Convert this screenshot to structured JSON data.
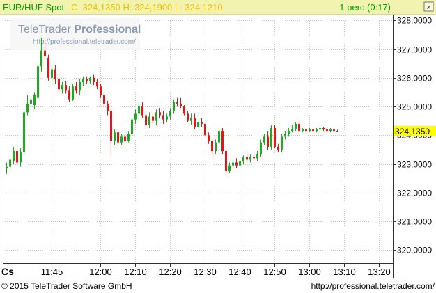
{
  "header": {
    "instrument": "EUR/HUF Spot",
    "quote_text": "C: 324,1350 H: 324,1900 L: 324,1210",
    "interval": "1 perc (0:17)"
  },
  "watermark": {
    "brand_light": "TeleTrader ",
    "brand_bold": "Professional",
    "url": "http://professional.teletrader.com/"
  },
  "price_tag": "324,1350",
  "xaxis_corner_label": "Cs",
  "footer": {
    "copyright": "© 2015 TeleTrader Software GmbH",
    "url": "http://professional.teletrader.com/"
  },
  "colors": {
    "up": "#22a822",
    "down": "#e01818",
    "header_bg": "#f3f3b0",
    "quote_text": "#f0c000",
    "price_tag_bg": "#ffff00",
    "grid": "#c8c8c8"
  },
  "chart_data": {
    "type": "candlestick",
    "title": "EUR/HUF Spot",
    "interval": "1 perc",
    "xlabel": "",
    "ylabel": "",
    "grid": true,
    "ylim": [
      319.55,
      328.2
    ],
    "xlim": [
      "11:32",
      "13:24"
    ],
    "y_ticks": [
      "320,0000",
      "321,0000",
      "322,0000",
      "323,0000",
      "324,0000",
      "325,0000",
      "326,0000",
      "327,0000",
      "328,0000"
    ],
    "y_tick_values": [
      320,
      321,
      322,
      323,
      324,
      325,
      326,
      327,
      328
    ],
    "x_ticks": [
      "11:45",
      "12:00",
      "12:10",
      "12:20",
      "12:30",
      "12:40",
      "12:50",
      "13:00",
      "13:10",
      "13:20"
    ],
    "x_tick_times": [
      "11:46",
      "12:00",
      "12:10",
      "12:20",
      "12:30",
      "12:40",
      "12:50",
      "13:00",
      "13:10",
      "13:20"
    ],
    "last_price": 324.135,
    "candles": [
      {
        "t": "11:33",
        "o": 322.85,
        "h": 323.05,
        "l": 322.65,
        "c": 322.9
      },
      {
        "t": "11:34",
        "o": 322.9,
        "h": 323.25,
        "l": 322.8,
        "c": 323.15
      },
      {
        "t": "11:35",
        "o": 323.1,
        "h": 323.6,
        "l": 323.0,
        "c": 323.45
      },
      {
        "t": "11:36",
        "o": 323.45,
        "h": 323.55,
        "l": 322.95,
        "c": 323.05
      },
      {
        "t": "11:37",
        "o": 323.05,
        "h": 323.55,
        "l": 322.9,
        "c": 323.4
      },
      {
        "t": "11:38",
        "o": 323.4,
        "h": 324.9,
        "l": 323.3,
        "c": 324.8
      },
      {
        "t": "11:39",
        "o": 324.8,
        "h": 325.4,
        "l": 324.7,
        "c": 325.1
      },
      {
        "t": "11:40",
        "o": 325.1,
        "h": 325.4,
        "l": 324.9,
        "c": 325.25
      },
      {
        "t": "11:41",
        "o": 325.05,
        "h": 325.5,
        "l": 324.9,
        "c": 325.4
      },
      {
        "t": "11:42",
        "o": 325.3,
        "h": 326.5,
        "l": 325.2,
        "c": 326.4
      },
      {
        "t": "11:43",
        "o": 326.4,
        "h": 327.4,
        "l": 326.2,
        "c": 326.95
      },
      {
        "t": "11:44",
        "o": 326.95,
        "h": 327.25,
        "l": 326.6,
        "c": 326.75
      },
      {
        "t": "11:45",
        "o": 326.7,
        "h": 326.8,
        "l": 325.9,
        "c": 326.0
      },
      {
        "t": "11:46",
        "o": 326.0,
        "h": 326.4,
        "l": 325.7,
        "c": 326.3
      },
      {
        "t": "11:47",
        "o": 326.3,
        "h": 326.45,
        "l": 325.8,
        "c": 325.95
      },
      {
        "t": "11:48",
        "o": 325.95,
        "h": 326.0,
        "l": 325.5,
        "c": 325.6
      },
      {
        "t": "11:49",
        "o": 325.6,
        "h": 325.85,
        "l": 325.45,
        "c": 325.75
      },
      {
        "t": "11:50",
        "o": 325.75,
        "h": 325.9,
        "l": 325.45,
        "c": 325.55
      },
      {
        "t": "11:51",
        "o": 325.55,
        "h": 325.7,
        "l": 325.15,
        "c": 325.25
      },
      {
        "t": "11:52",
        "o": 325.25,
        "h": 325.8,
        "l": 325.2,
        "c": 325.7
      },
      {
        "t": "11:53",
        "o": 325.7,
        "h": 325.85,
        "l": 325.45,
        "c": 325.55
      },
      {
        "t": "11:54",
        "o": 325.55,
        "h": 325.95,
        "l": 325.4,
        "c": 325.85
      },
      {
        "t": "11:55",
        "o": 325.85,
        "h": 326.05,
        "l": 325.7,
        "c": 325.95
      },
      {
        "t": "11:56",
        "o": 325.95,
        "h": 326.05,
        "l": 325.8,
        "c": 325.9
      },
      {
        "t": "11:57",
        "o": 325.9,
        "h": 326.05,
        "l": 325.8,
        "c": 326.0
      },
      {
        "t": "11:58",
        "o": 326.0,
        "h": 326.1,
        "l": 325.75,
        "c": 325.85
      },
      {
        "t": "11:59",
        "o": 325.85,
        "h": 325.95,
        "l": 325.6,
        "c": 325.7
      },
      {
        "t": "12:00",
        "o": 325.7,
        "h": 325.8,
        "l": 325.3,
        "c": 325.4
      },
      {
        "t": "12:01",
        "o": 325.4,
        "h": 325.5,
        "l": 325.0,
        "c": 325.1
      },
      {
        "t": "12:02",
        "o": 325.1,
        "h": 325.2,
        "l": 324.7,
        "c": 324.85
      },
      {
        "t": "12:03",
        "o": 324.85,
        "h": 324.95,
        "l": 323.3,
        "c": 323.8
      },
      {
        "t": "12:04",
        "o": 323.8,
        "h": 324.2,
        "l": 323.65,
        "c": 324.1
      },
      {
        "t": "12:05",
        "o": 324.1,
        "h": 324.2,
        "l": 323.65,
        "c": 323.75
      },
      {
        "t": "12:06",
        "o": 323.75,
        "h": 324.05,
        "l": 323.65,
        "c": 323.95
      },
      {
        "t": "12:07",
        "o": 323.95,
        "h": 324.05,
        "l": 323.7,
        "c": 323.8
      },
      {
        "t": "12:08",
        "o": 323.8,
        "h": 324.15,
        "l": 323.75,
        "c": 324.05
      },
      {
        "t": "12:09",
        "o": 324.05,
        "h": 324.65,
        "l": 323.95,
        "c": 324.55
      },
      {
        "t": "12:10",
        "o": 324.55,
        "h": 324.9,
        "l": 324.4,
        "c": 324.75
      },
      {
        "t": "12:11",
        "o": 324.75,
        "h": 325.2,
        "l": 324.5,
        "c": 325.0
      },
      {
        "t": "12:12",
        "o": 325.0,
        "h": 325.15,
        "l": 324.6,
        "c": 324.7
      },
      {
        "t": "12:13",
        "o": 324.7,
        "h": 324.8,
        "l": 324.2,
        "c": 324.35
      },
      {
        "t": "12:14",
        "o": 324.35,
        "h": 324.8,
        "l": 324.25,
        "c": 324.65
      },
      {
        "t": "12:15",
        "o": 324.65,
        "h": 324.75,
        "l": 324.4,
        "c": 324.5
      },
      {
        "t": "12:16",
        "o": 324.5,
        "h": 324.9,
        "l": 324.35,
        "c": 324.8
      },
      {
        "t": "12:17",
        "o": 324.8,
        "h": 324.95,
        "l": 324.6,
        "c": 324.7
      },
      {
        "t": "12:18",
        "o": 324.7,
        "h": 324.85,
        "l": 324.4,
        "c": 324.55
      },
      {
        "t": "12:19",
        "o": 324.55,
        "h": 324.75,
        "l": 324.45,
        "c": 324.65
      },
      {
        "t": "12:20",
        "o": 324.65,
        "h": 324.95,
        "l": 324.55,
        "c": 324.85
      },
      {
        "t": "12:21",
        "o": 324.85,
        "h": 325.25,
        "l": 324.75,
        "c": 325.15
      },
      {
        "t": "12:22",
        "o": 325.15,
        "h": 325.3,
        "l": 325.0,
        "c": 325.1
      },
      {
        "t": "12:23",
        "o": 325.1,
        "h": 325.3,
        "l": 324.95,
        "c": 325.0
      },
      {
        "t": "12:24",
        "o": 325.0,
        "h": 325.05,
        "l": 324.7,
        "c": 324.75
      },
      {
        "t": "12:25",
        "o": 324.75,
        "h": 324.85,
        "l": 324.45,
        "c": 324.5
      },
      {
        "t": "12:26",
        "o": 324.5,
        "h": 324.75,
        "l": 324.35,
        "c": 324.6
      },
      {
        "t": "12:27",
        "o": 324.6,
        "h": 324.75,
        "l": 324.2,
        "c": 324.3
      },
      {
        "t": "12:28",
        "o": 324.3,
        "h": 324.55,
        "l": 324.15,
        "c": 324.45
      },
      {
        "t": "12:29",
        "o": 324.45,
        "h": 324.6,
        "l": 324.3,
        "c": 324.4
      },
      {
        "t": "12:30",
        "o": 324.4,
        "h": 324.45,
        "l": 323.9,
        "c": 324.0
      },
      {
        "t": "12:31",
        "o": 324.0,
        "h": 324.1,
        "l": 323.7,
        "c": 323.8
      },
      {
        "t": "12:32",
        "o": 323.8,
        "h": 323.9,
        "l": 323.2,
        "c": 323.45
      },
      {
        "t": "12:33",
        "o": 323.45,
        "h": 323.85,
        "l": 323.35,
        "c": 323.75
      },
      {
        "t": "12:34",
        "o": 323.75,
        "h": 324.25,
        "l": 323.65,
        "c": 324.15
      },
      {
        "t": "12:35",
        "o": 324.15,
        "h": 324.25,
        "l": 323.35,
        "c": 323.45
      },
      {
        "t": "12:36",
        "o": 323.45,
        "h": 323.55,
        "l": 322.65,
        "c": 322.75
      },
      {
        "t": "12:37",
        "o": 322.75,
        "h": 323.05,
        "l": 322.7,
        "c": 322.95
      },
      {
        "t": "12:38",
        "o": 322.95,
        "h": 323.15,
        "l": 322.85,
        "c": 323.05
      },
      {
        "t": "12:39",
        "o": 323.05,
        "h": 323.2,
        "l": 322.85,
        "c": 322.95
      },
      {
        "t": "12:40",
        "o": 322.95,
        "h": 323.15,
        "l": 322.85,
        "c": 323.1
      },
      {
        "t": "12:41",
        "o": 323.1,
        "h": 323.3,
        "l": 323.0,
        "c": 323.25
      },
      {
        "t": "12:42",
        "o": 323.25,
        "h": 323.35,
        "l": 323.05,
        "c": 323.15
      },
      {
        "t": "12:43",
        "o": 323.15,
        "h": 323.35,
        "l": 323.05,
        "c": 323.25
      },
      {
        "t": "12:44",
        "o": 323.25,
        "h": 323.4,
        "l": 323.1,
        "c": 323.2
      },
      {
        "t": "12:45",
        "o": 323.2,
        "h": 323.45,
        "l": 323.1,
        "c": 323.35
      },
      {
        "t": "12:46",
        "o": 323.35,
        "h": 323.85,
        "l": 323.25,
        "c": 323.75
      },
      {
        "t": "12:47",
        "o": 323.75,
        "h": 324.05,
        "l": 323.65,
        "c": 323.95
      },
      {
        "t": "12:48",
        "o": 323.95,
        "h": 324.15,
        "l": 323.5,
        "c": 323.6
      },
      {
        "t": "12:49",
        "o": 323.6,
        "h": 324.35,
        "l": 323.5,
        "c": 324.25
      },
      {
        "t": "12:50",
        "o": 324.25,
        "h": 324.35,
        "l": 323.55,
        "c": 323.6
      },
      {
        "t": "12:51",
        "o": 323.6,
        "h": 323.7,
        "l": 323.4,
        "c": 323.5
      },
      {
        "t": "12:52",
        "o": 323.5,
        "h": 324.05,
        "l": 323.4,
        "c": 323.95
      },
      {
        "t": "12:53",
        "o": 323.95,
        "h": 324.15,
        "l": 323.85,
        "c": 324.05
      },
      {
        "t": "12:54",
        "o": 324.05,
        "h": 324.25,
        "l": 323.95,
        "c": 324.15
      },
      {
        "t": "12:55",
        "o": 324.15,
        "h": 324.35,
        "l": 324.1,
        "c": 324.2
      },
      {
        "t": "12:56",
        "o": 324.2,
        "h": 324.45,
        "l": 324.15,
        "c": 324.4
      },
      {
        "t": "12:57",
        "o": 324.4,
        "h": 324.5,
        "l": 324.1,
        "c": 324.15
      },
      {
        "t": "12:58",
        "o": 324.15,
        "h": 324.25,
        "l": 324.1,
        "c": 324.2
      },
      {
        "t": "12:59",
        "o": 324.2,
        "h": 324.25,
        "l": 324.1,
        "c": 324.15
      },
      {
        "t": "13:00",
        "o": 324.15,
        "h": 324.25,
        "l": 324.1,
        "c": 324.2
      },
      {
        "t": "13:01",
        "o": 324.2,
        "h": 324.25,
        "l": 324.1,
        "c": 324.15
      },
      {
        "t": "13:02",
        "o": 324.15,
        "h": 324.25,
        "l": 324.1,
        "c": 324.2
      },
      {
        "t": "13:03",
        "o": 324.2,
        "h": 324.3,
        "l": 324.15,
        "c": 324.25
      },
      {
        "t": "13:04",
        "o": 324.25,
        "h": 324.3,
        "l": 324.15,
        "c": 324.2
      },
      {
        "t": "13:05",
        "o": 324.2,
        "h": 324.25,
        "l": 324.1,
        "c": 324.15
      },
      {
        "t": "13:06",
        "o": 324.15,
        "h": 324.25,
        "l": 324.1,
        "c": 324.2
      },
      {
        "t": "13:07",
        "o": 324.2,
        "h": 324.25,
        "l": 324.1,
        "c": 324.15
      },
      {
        "t": "13:08",
        "o": 324.15,
        "h": 324.19,
        "l": 324.121,
        "c": 324.135
      }
    ]
  }
}
